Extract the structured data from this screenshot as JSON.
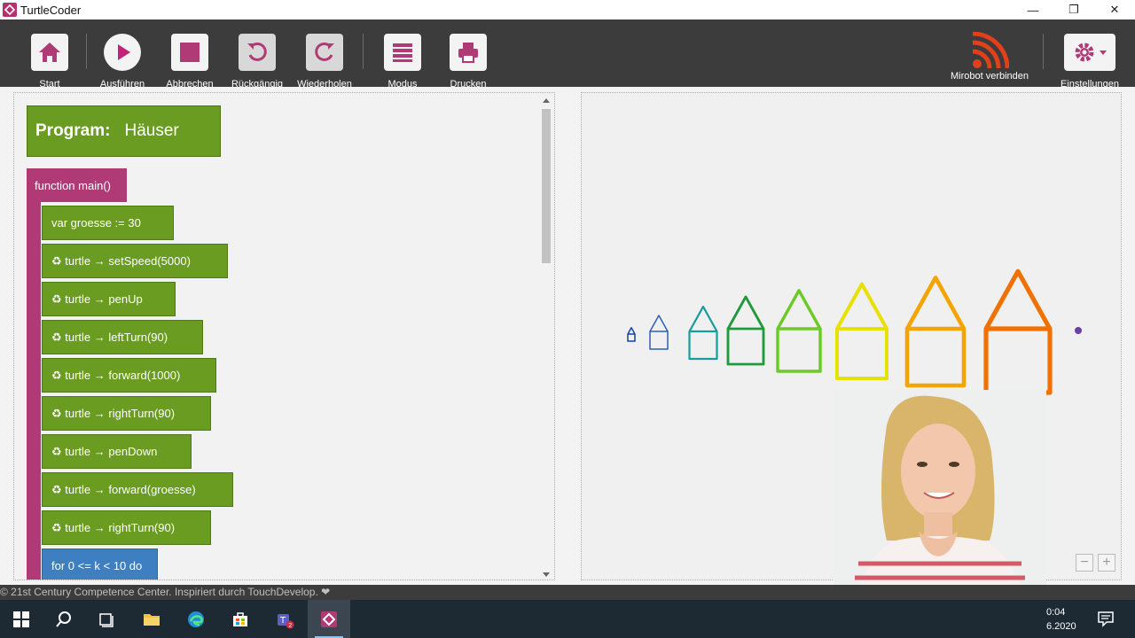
{
  "window": {
    "title": "TurtleCoder"
  },
  "toolbar": {
    "start": "Start",
    "run": "Ausführen",
    "cancel": "Abbrechen",
    "undo": "Rückgängig",
    "redo": "Wiederholen",
    "mode": "Modus",
    "print": "Drucken",
    "mirobot": "Mirobot verbinden",
    "settings": "Einstellungen"
  },
  "program": {
    "label": "Program:",
    "name": "Häuser"
  },
  "function": {
    "label": "function main()"
  },
  "statements": [
    {
      "text": "var groesse := 30",
      "type": "var"
    },
    {
      "text": "♻ turtle → setSpeed(5000)",
      "type": "call"
    },
    {
      "text": "♻ turtle → penUp",
      "type": "call"
    },
    {
      "text": "♻ turtle → leftTurn(90)",
      "type": "call"
    },
    {
      "text": "♻ turtle → forward(1000)",
      "type": "call"
    },
    {
      "text": "♻ turtle → rightTurn(90)",
      "type": "call"
    },
    {
      "text": "♻ turtle → penDown",
      "type": "call"
    },
    {
      "text": "♻ turtle → forward(groesse)",
      "type": "call"
    },
    {
      "text": "♻ turtle → rightTurn(90)",
      "type": "call"
    },
    {
      "text": "for 0 <= k < 10 do",
      "type": "loop"
    }
  ],
  "canvas": {
    "house_colors": [
      "#1a3f9a",
      "#2d5fb4",
      "#1b9c9c",
      "#1f9a3a",
      "#6cc926",
      "#e8e000",
      "#f4a400",
      "#f07000"
    ]
  },
  "footer": {
    "text": "© 21st Century Competence Center. Inspiriert durch TouchDevelop. ❤"
  },
  "taskbar": {
    "time": "0:04",
    "date": "6.2020"
  },
  "colors": {
    "accent": "#b03a76",
    "block_green": "#6a9c22",
    "block_blue": "#3d7fc1",
    "toolbar": "#3c3c3c"
  }
}
